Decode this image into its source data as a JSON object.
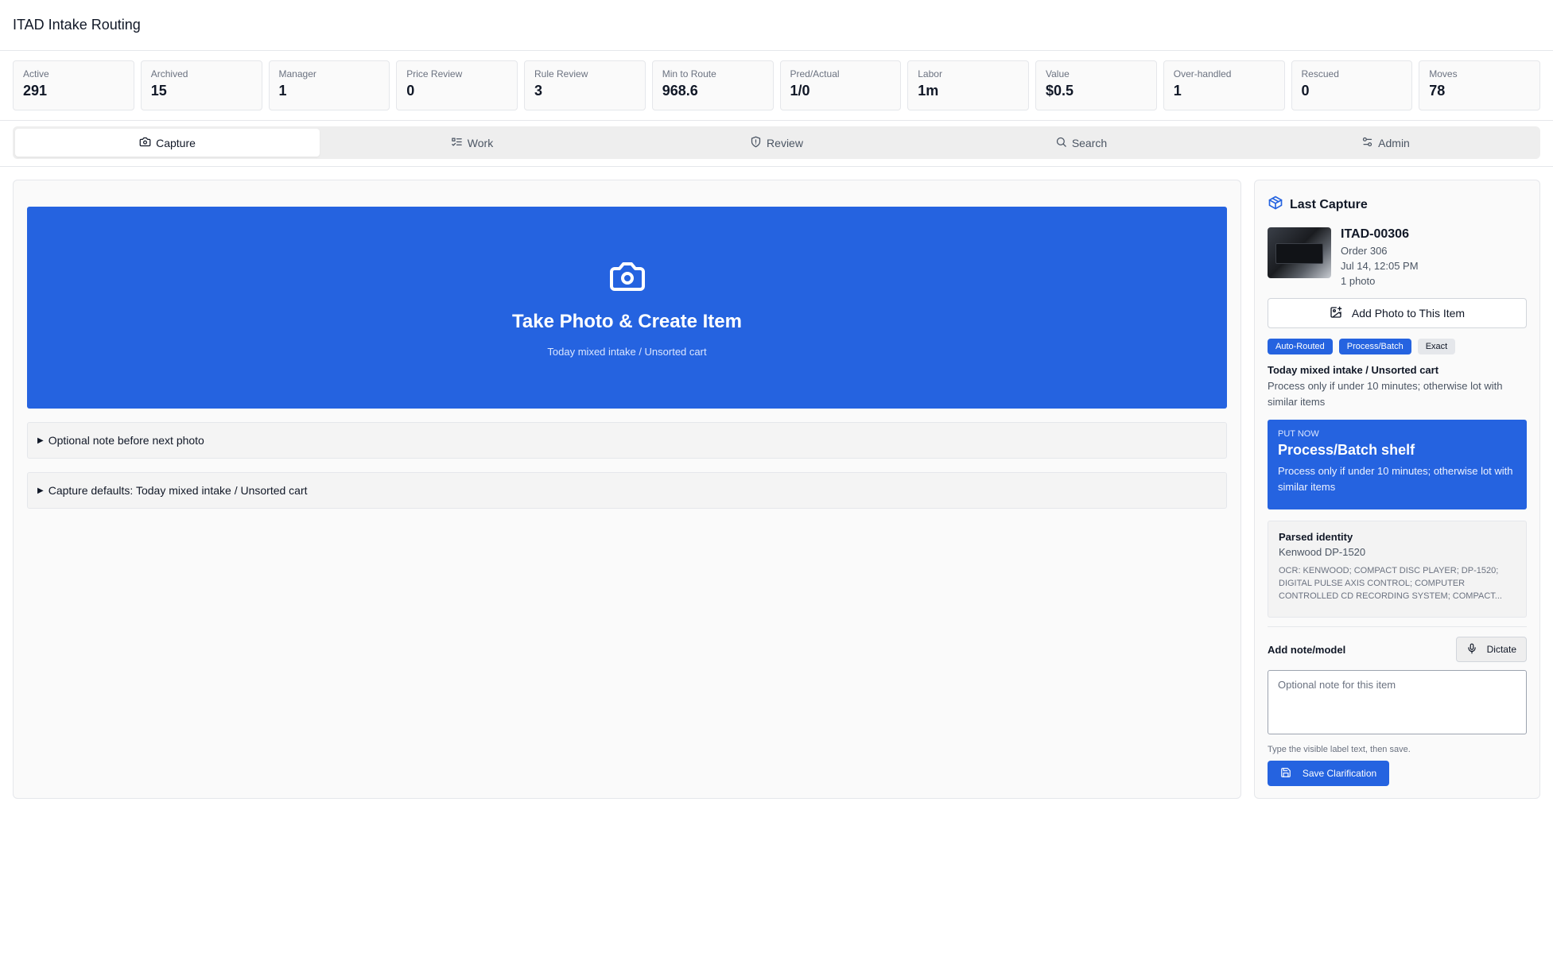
{
  "app": {
    "title": "ITAD Intake Routing"
  },
  "stats": [
    {
      "label": "Active",
      "value": "291"
    },
    {
      "label": "Archived",
      "value": "15"
    },
    {
      "label": "Manager",
      "value": "1"
    },
    {
      "label": "Price Review",
      "value": "0"
    },
    {
      "label": "Rule Review",
      "value": "3"
    },
    {
      "label": "Min to Route",
      "value": "968.6"
    },
    {
      "label": "Pred/Actual",
      "value": "1/0"
    },
    {
      "label": "Labor",
      "value": "1m"
    },
    {
      "label": "Value",
      "value": "$0.5"
    },
    {
      "label": "Over-handled",
      "value": "1"
    },
    {
      "label": "Rescued",
      "value": "0"
    },
    {
      "label": "Moves",
      "value": "78"
    }
  ],
  "tabs": [
    {
      "label": "Capture",
      "icon": "camera-icon",
      "active": true
    },
    {
      "label": "Work",
      "icon": "list-checks-icon",
      "active": false
    },
    {
      "label": "Review",
      "icon": "shield-icon",
      "active": false
    },
    {
      "label": "Search",
      "icon": "search-icon",
      "active": false
    },
    {
      "label": "Admin",
      "icon": "sliders-icon",
      "active": false
    }
  ],
  "capture": {
    "title": "Take Photo & Create Item",
    "subtitle": "Today mixed intake / Unsorted cart",
    "icon": "camera-icon"
  },
  "optional_note": {
    "label": "Optional note before next photo"
  },
  "capture_defaults": {
    "label": "Capture defaults: Today mixed intake / Unsorted cart"
  },
  "last_capture": {
    "heading": "Last Capture",
    "icon": "package-icon",
    "item_id": "ITAD-00306",
    "order": "Order 306",
    "timestamp": "Jul 14, 12:05 PM",
    "photos": "1 photo",
    "add_photo_label": "Add Photo to This Item",
    "badges": [
      {
        "label": "Auto-Routed",
        "style": "blue"
      },
      {
        "label": "Process/Batch",
        "style": "blue"
      },
      {
        "label": "Exact",
        "style": "gray"
      }
    ],
    "route_title": "Today mixed intake / Unsorted cart",
    "route_desc": "Process only if under 10 minutes; otherwise lot with similar items",
    "put_now": {
      "kicker": "PUT NOW",
      "title": "Process/Batch shelf",
      "desc": "Process only if under 10 minutes; otherwise lot with similar items"
    },
    "identity": {
      "heading": "Parsed identity",
      "model": "Kenwood DP-1520",
      "ocr": "OCR: KENWOOD; COMPACT DISC PLAYER; DP-1520; DIGITAL PULSE AXIS CONTROL; COMPUTER CONTROLLED CD RECORDING SYSTEM; COMPACT..."
    },
    "note": {
      "label": "Add note/model",
      "dictate_label": "Dictate",
      "placeholder": "Optional note for this item",
      "value": "",
      "hint": "Type the visible label text, then save.",
      "save_label": "Save Clarification"
    }
  },
  "colors": {
    "accent": "#2563e0",
    "panel": "#fafafa",
    "border": "#e5e7eb"
  }
}
